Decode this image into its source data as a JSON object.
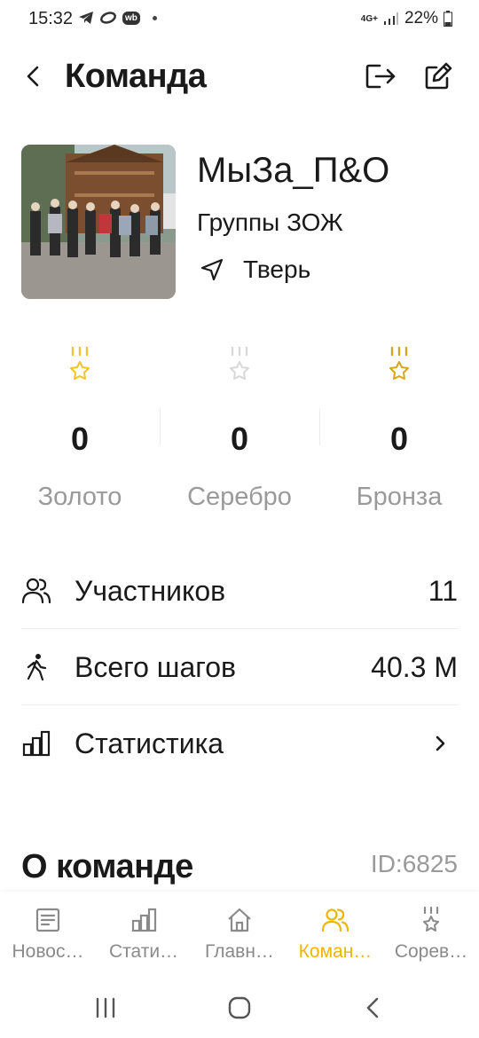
{
  "status_bar": {
    "time": "15:32",
    "app_badge": "wb",
    "network": "4G+",
    "battery": "22%"
  },
  "header": {
    "title": "Команда"
  },
  "team": {
    "name": "МыЗа_П&О",
    "group": "Группы ЗОЖ",
    "city": "Тверь"
  },
  "medals": [
    {
      "count": "0",
      "label": "Золото",
      "color": "#f2c230"
    },
    {
      "count": "0",
      "label": "Серебро",
      "color": "#d8d8d8"
    },
    {
      "count": "0",
      "label": "Бронза",
      "color": "#d9a520"
    }
  ],
  "stats": {
    "members": {
      "label": "Участников",
      "value": "11"
    },
    "steps": {
      "label": "Всего шагов",
      "value": "40.3 M"
    },
    "statistics": {
      "label": "Статистика"
    }
  },
  "about": {
    "title": "О команде",
    "id": "ID:6825"
  },
  "nav": [
    {
      "label": "Новос…",
      "icon": "news-icon"
    },
    {
      "label": "Стати…",
      "icon": "stats-icon"
    },
    {
      "label": "Главн…",
      "icon": "home-icon"
    },
    {
      "label": "Коман…",
      "icon": "team-icon",
      "active": true
    },
    {
      "label": "Сорев…",
      "icon": "medal-icon"
    }
  ],
  "colors": {
    "accent": "#f0b400",
    "muted": "#9a9a9a"
  }
}
